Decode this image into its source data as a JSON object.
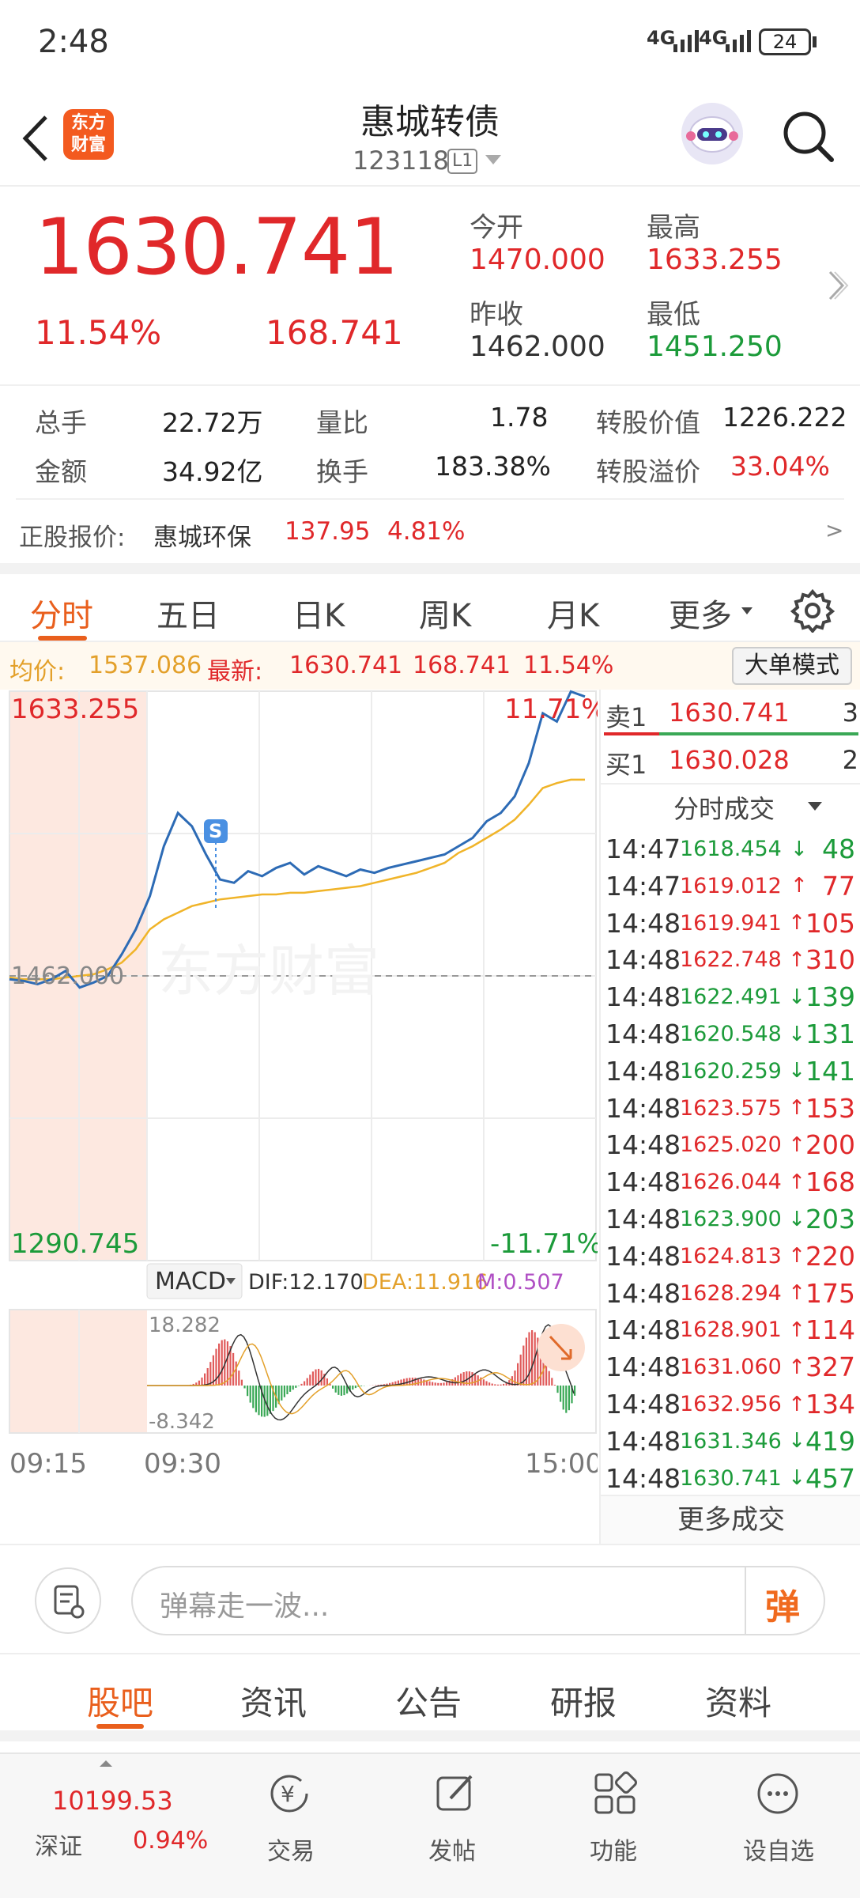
{
  "status": {
    "time": "2:48",
    "signal1": "4G",
    "signal2": "4G",
    "battery": "24"
  },
  "nav": {
    "logo_line1": "东方",
    "logo_line2": "财富",
    "title": "惠城转债",
    "code": "123118",
    "level": "L1"
  },
  "quote": {
    "price": "1630.741",
    "pct": "11.54%",
    "change": "168.741",
    "open_label": "今开",
    "open": "1470.000",
    "high_label": "最高",
    "high": "1633.255",
    "prev_label": "昨收",
    "prev": "1462.000",
    "low_label": "最低",
    "low": "1451.250"
  },
  "stats": {
    "vol_label": "总手",
    "vol": "22.72万",
    "ratio_label": "量比",
    "ratio": "1.78",
    "conv_val_label": "转股价值",
    "conv_val": "1226.222",
    "amt_label": "金额",
    "amt": "34.92亿",
    "turnover_label": "换手",
    "turnover": "183.38%",
    "premium_label": "转股溢价",
    "premium": "33.04%",
    "underlying_label": "正股报价:",
    "underlying_name": "惠城环保",
    "underlying_price": "137.95",
    "underlying_pct": "4.81%",
    "more": ">"
  },
  "tabs": {
    "t1": "分时",
    "t2": "五日",
    "t3": "日K",
    "t4": "周K",
    "t5": "月K",
    "t6": "更多"
  },
  "infobar": {
    "avg_label": "均价:",
    "avg": "1537.086",
    "latest_label": "最新:",
    "latest": "1630.741",
    "chg": "168.741",
    "pct": "11.54%",
    "mode_btn": "大单模式"
  },
  "chart": {
    "top_price": "1633.255",
    "bottom_price": "1290.745",
    "top_pct": "11.71%",
    "bottom_pct": "-11.71%",
    "prev_close": "1462.000",
    "marker": "S",
    "watermark": "东方财富",
    "macd_label": "MACD",
    "dif": "DIF:12.170",
    "dea": "DEA:11.916",
    "m": "M:0.507",
    "macd_top": "18.282",
    "macd_bottom": "-8.342",
    "time_start": "09:15",
    "time_open": "09:30",
    "time_end": "15:00"
  },
  "chart_data": {
    "type": "line",
    "title": "",
    "ylim": [
      1290.745,
      1633.255
    ],
    "reference": 1462.0,
    "series": [
      {
        "values": [
          1460,
          1459,
          1457,
          1460,
          1465,
          1455,
          1458,
          1462,
          1475,
          1490,
          1510,
          1540,
          1560,
          1552,
          1535,
          1520,
          1518,
          1525,
          1522,
          1527,
          1530,
          1523,
          1528,
          1525,
          1522,
          1526,
          1524,
          1527,
          1529,
          1531,
          1533,
          1535,
          1540,
          1545,
          1555,
          1560,
          1570,
          1590,
          1620,
          1615,
          1633,
          1630
        ]
      },
      {
        "values": [
          1461,
          1460,
          1460,
          1460,
          1461,
          1462,
          1463,
          1466,
          1470,
          1478,
          1490,
          1496,
          1500,
          1504,
          1506,
          1508,
          1509,
          1510,
          1511,
          1511,
          1512,
          1512,
          1513,
          1514,
          1515,
          1516,
          1518,
          1520,
          1522,
          1524,
          1527,
          1530,
          1536,
          1540,
          1545,
          1550,
          1556,
          1565,
          1575,
          1578,
          1580,
          1580
        ]
      }
    ]
  },
  "trades": {
    "sell1_label": "卖1",
    "sell1_price": "1630.741",
    "sell1_vol": "3",
    "buy1_label": "买1",
    "buy1_price": "1630.028",
    "buy1_vol": "2",
    "header": "分时成交",
    "rows": [
      {
        "t": "14:47",
        "p": "1618.454",
        "a": "↓",
        "v": "48",
        "c": "green"
      },
      {
        "t": "14:47",
        "p": "1619.012",
        "a": "↑",
        "v": "77",
        "c": "red"
      },
      {
        "t": "14:48",
        "p": "1619.941",
        "a": "↑",
        "v": "105",
        "c": "red"
      },
      {
        "t": "14:48",
        "p": "1622.748",
        "a": "↑",
        "v": "310",
        "c": "red"
      },
      {
        "t": "14:48",
        "p": "1622.491",
        "a": "↓",
        "v": "139",
        "c": "green"
      },
      {
        "t": "14:48",
        "p": "1620.548",
        "a": "↓",
        "v": "131",
        "c": "green"
      },
      {
        "t": "14:48",
        "p": "1620.259",
        "a": "↓",
        "v": "141",
        "c": "green"
      },
      {
        "t": "14:48",
        "p": "1623.575",
        "a": "↑",
        "v": "153",
        "c": "red"
      },
      {
        "t": "14:48",
        "p": "1625.020",
        "a": "↑",
        "v": "200",
        "c": "red"
      },
      {
        "t": "14:48",
        "p": "1626.044",
        "a": "↑",
        "v": "168",
        "c": "red"
      },
      {
        "t": "14:48",
        "p": "1623.900",
        "a": "↓",
        "v": "203",
        "c": "green"
      },
      {
        "t": "14:48",
        "p": "1624.813",
        "a": "↑",
        "v": "220",
        "c": "red"
      },
      {
        "t": "14:48",
        "p": "1628.294",
        "a": "↑",
        "v": "175",
        "c": "red"
      },
      {
        "t": "14:48",
        "p": "1628.901",
        "a": "↑",
        "v": "114",
        "c": "red"
      },
      {
        "t": "14:48",
        "p": "1631.060",
        "a": "↑",
        "v": "327",
        "c": "red"
      },
      {
        "t": "14:48",
        "p": "1632.956",
        "a": "↑",
        "v": "134",
        "c": "red"
      },
      {
        "t": "14:48",
        "p": "1631.346",
        "a": "↓",
        "v": "419",
        "c": "green"
      },
      {
        "t": "14:48",
        "p": "1630.741",
        "a": "↓",
        "v": "457",
        "c": "green"
      }
    ],
    "more": "更多成交"
  },
  "danmu": {
    "placeholder": "弹幕走一波...",
    "btn": "弹"
  },
  "bottomtabs": {
    "b1": "股吧",
    "b2": "资讯",
    "b3": "公告",
    "b4": "研报",
    "b5": "资料"
  },
  "dock": {
    "index_val": "10199.53",
    "index_name": "深证",
    "index_pct": "0.94%",
    "trade": "交易",
    "post": "发帖",
    "func": "功能",
    "watch": "设自选"
  }
}
